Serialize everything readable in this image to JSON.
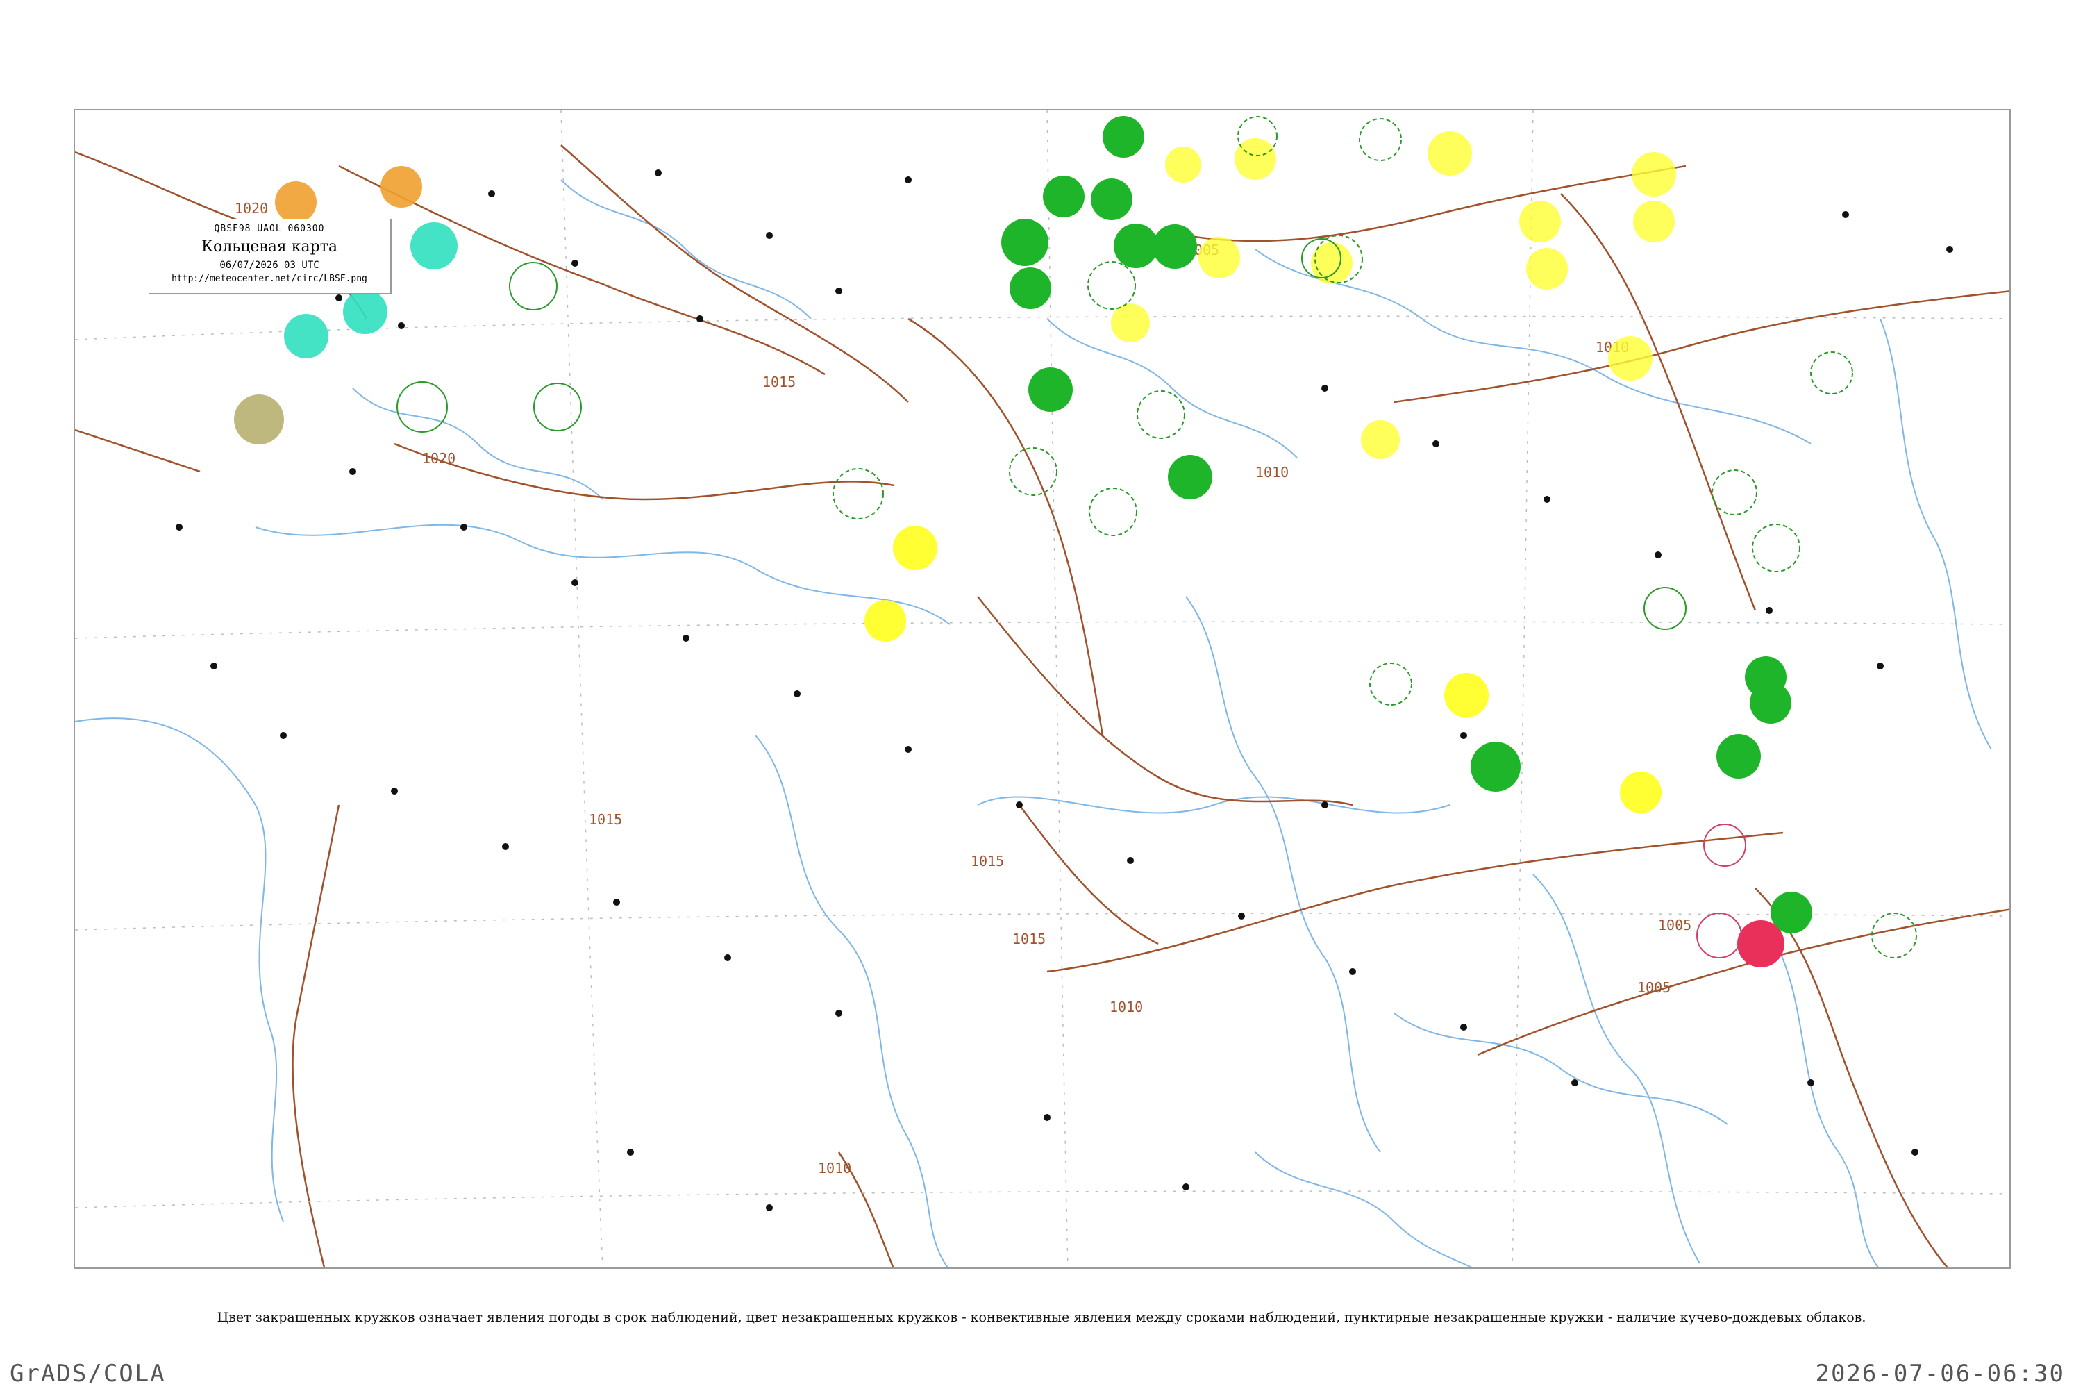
{
  "header": {
    "code_line": "QBSF98  UAOL  060300",
    "title": "Кольцевая карта",
    "date": "06/07/2026 03 UTC",
    "url": "http://meteocenter.net/circ/LBSF.png"
  },
  "caption": "Цвет закрашенных кружков означает явления погоды в срок наблюдений, цвет незакрашенных кружков - конвективные явления между сроками наблюдений, пунктирные незакрашенные кружки - наличие кучево-дождевых облаков.",
  "footer": {
    "left": "GrADS/COLA",
    "right": "2026-07-06-06:30"
  },
  "colors": {
    "isobar": "#a0522d",
    "river": "#7fb7e6",
    "frame": "#9a9a9a",
    "green_phenomena": "#1fb52b",
    "yellow_phenomena": "#ffff33",
    "orange_phenomena": "#f0a030",
    "cyan_phenomena": "#30e0c0",
    "olive_phenomena": "#b8b070",
    "red_phenomena": "#e8305a",
    "dashed_circle": "#2a9a2a",
    "pink_circle": "#d0406a"
  },
  "isobar_labels": [
    "1020",
    "1020",
    "1015",
    "1015",
    "1015",
    "1010",
    "1010",
    "1005",
    "1005",
    "1010",
    "1015",
    "1005",
    "1010"
  ],
  "legend_note_icons": [
    "filled-circle-phenomena",
    "open-circle-convective",
    "dashed-circle-cumulonimbus"
  ]
}
